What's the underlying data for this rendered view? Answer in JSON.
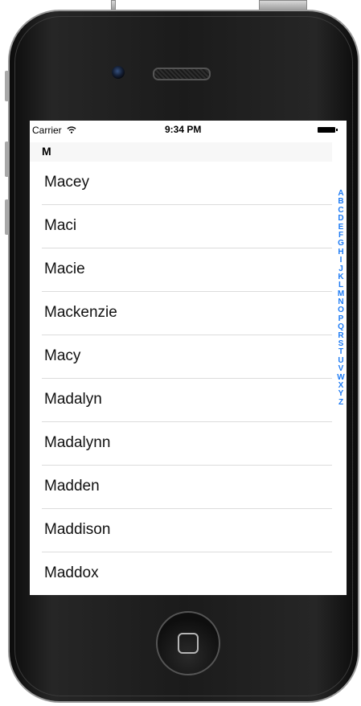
{
  "status_bar": {
    "carrier": "Carrier",
    "wifi_icon": "wifi-icon",
    "time": "9:34 PM",
    "battery_icon": "battery-icon"
  },
  "section": {
    "header": "M"
  },
  "rows": [
    "Macey",
    "Maci",
    "Macie",
    "Mackenzie",
    "Macy",
    "Madalyn",
    "Madalynn",
    "Madden",
    "Maddison",
    "Maddox"
  ],
  "section_index": [
    "A",
    "B",
    "C",
    "D",
    "E",
    "F",
    "G",
    "H",
    "I",
    "J",
    "K",
    "L",
    "M",
    "N",
    "O",
    "P",
    "Q",
    "R",
    "S",
    "T",
    "U",
    "V",
    "W",
    "X",
    "Y",
    "Z"
  ],
  "colors": {
    "index_accent": "#1f7cf5",
    "section_header_bg": "#f7f7f7",
    "separator": "#dcdcdc"
  }
}
